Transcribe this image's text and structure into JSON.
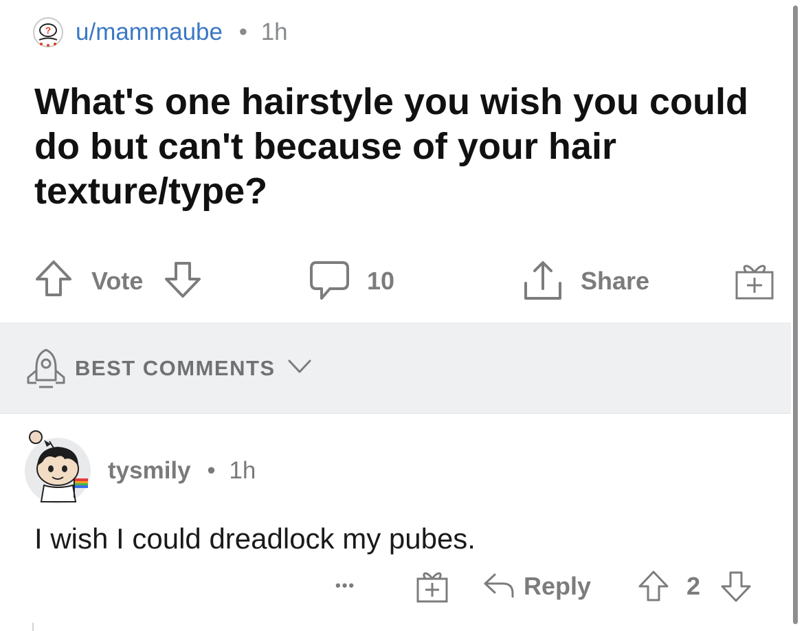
{
  "post": {
    "author": "u/mammaube",
    "separator": "•",
    "time": "1h",
    "title": "What's one hairstyle you wish you could do but can't because of your hair texture/type?"
  },
  "actions": {
    "vote_label": "Vote",
    "comment_count": "10",
    "share_label": "Share"
  },
  "sort": {
    "label": "BEST COMMENTS"
  },
  "comments": [
    {
      "author": "tysmily",
      "separator": "•",
      "time": "1h",
      "body": "I wish I could dreadlock my pubes.",
      "more_label": "•••",
      "reply_label": "Reply",
      "score": "2"
    }
  ],
  "colors": {
    "link": "#3b78c4",
    "muted": "#7c7c7c",
    "sort_bg": "#eff0f2",
    "title": "#111111"
  },
  "icons": {
    "author_avatar": "snoo-question-avatar-icon",
    "upvote": "arrow-up-icon",
    "downvote": "arrow-down-icon",
    "comment": "speech-bubble-icon",
    "share": "share-upload-icon",
    "award": "gift-plus-icon",
    "sort": "rocket-icon",
    "dropdown": "chevron-down-icon",
    "reply": "reply-arrow-icon"
  }
}
